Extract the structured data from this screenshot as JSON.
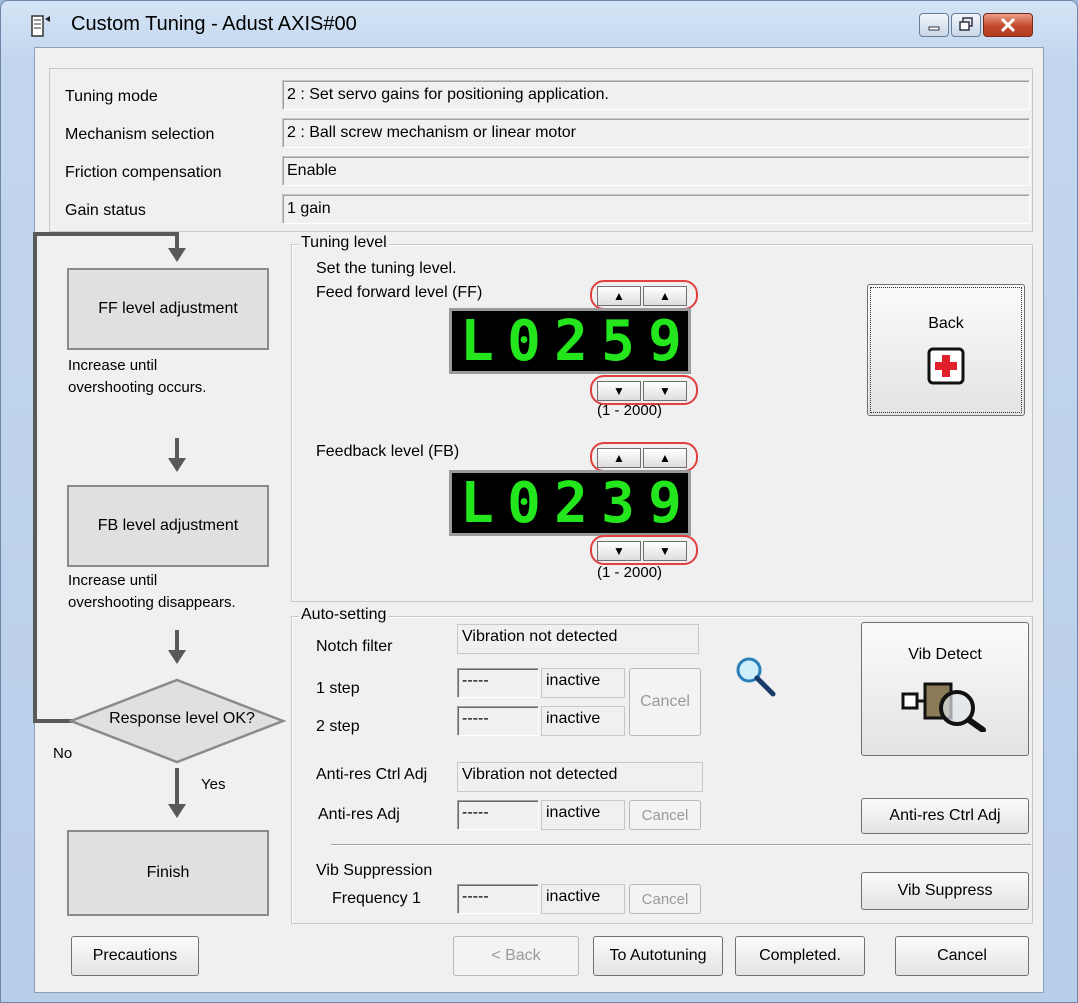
{
  "window": {
    "title": "Custom Tuning - Adust AXIS#00"
  },
  "info": {
    "rows": [
      {
        "label": "Tuning mode",
        "value": "2 : Set servo gains for positioning application."
      },
      {
        "label": "Mechanism selection",
        "value": "2 : Ball screw mechanism or linear motor"
      },
      {
        "label": "Friction compensation",
        "value": "Enable"
      },
      {
        "label": "Gain status",
        "value": "1 gain"
      }
    ]
  },
  "flow": {
    "ff_box": "FF level adjustment",
    "ff_note_1": "Increase until",
    "ff_note_2": "overshooting occurs.",
    "fb_box": "FB level adjustment",
    "fb_note_1": "Increase until",
    "fb_note_2": "overshooting disappears.",
    "decision": "Response level OK?",
    "no_label": "No",
    "yes_label": "Yes",
    "finish_box": "Finish"
  },
  "tuning_level": {
    "group_title": "Tuning level",
    "instruction": "Set the tuning level.",
    "ff_label": "Feed forward level (FF)",
    "ff_display": [
      "L",
      "0",
      "2",
      "5",
      "9"
    ],
    "ff_range": "(1 - 2000)",
    "fb_label": "Feedback level (FB)",
    "fb_display": [
      "L",
      "0",
      "2",
      "3",
      "9"
    ],
    "fb_range": "(1 - 2000)",
    "up_glyph": "▲",
    "down_glyph": "▼",
    "back_label": "Back"
  },
  "auto_setting": {
    "group_title": "Auto-setting",
    "notch_label": "Notch filter",
    "notch_status": "Vibration not detected",
    "step1_label": "1 step",
    "step1_value": "-----",
    "step1_state": "inactive",
    "step2_label": "2 step",
    "step2_value": "-----",
    "step2_state": "inactive",
    "notch_cancel": "Cancel",
    "vib_detect_label": "Vib Detect",
    "antires_label": "Anti-res Ctrl Adj",
    "antires_status": "Vibration not detected",
    "antires_adj_label": "Anti-res Adj",
    "antires_adj_value": "-----",
    "antires_adj_state": "inactive",
    "antires_cancel": "Cancel",
    "antires_button": "Anti-res Ctrl Adj",
    "vibsup_label": "Vib Suppression",
    "freq1_label": "Frequency 1",
    "freq1_value": "-----",
    "freq1_state": "inactive",
    "vibsup_cancel": "Cancel",
    "vibsup_button": "Vib Suppress"
  },
  "footer": {
    "precautions": "Precautions",
    "back": "< Back",
    "to_autotuning": "To Autotuning",
    "completed": "Completed.",
    "cancel": "Cancel"
  }
}
